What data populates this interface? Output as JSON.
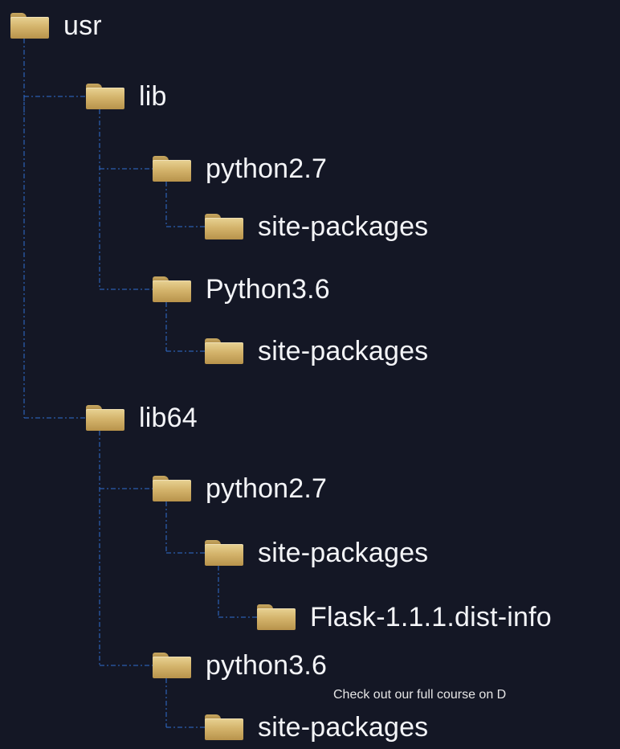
{
  "tree": {
    "line_color": "#2f6fd1",
    "folder_color": "#d4b46c",
    "nodes": [
      {
        "id": "usr",
        "label": "usr",
        "depth": 0
      },
      {
        "id": "lib",
        "label": "lib",
        "depth": 1,
        "parent": "usr"
      },
      {
        "id": "lib-python27",
        "label": "python2.7",
        "depth": 2,
        "parent": "lib"
      },
      {
        "id": "lib-python27-sp",
        "label": "site-packages",
        "depth": 3,
        "parent": "lib-python27"
      },
      {
        "id": "lib-python36",
        "label": "Python3.6",
        "depth": 2,
        "parent": "lib"
      },
      {
        "id": "lib-python36-sp",
        "label": "site-packages",
        "depth": 3,
        "parent": "lib-python36"
      },
      {
        "id": "lib64",
        "label": "lib64",
        "depth": 1,
        "parent": "usr"
      },
      {
        "id": "lib64-python27",
        "label": "python2.7",
        "depth": 2,
        "parent": "lib64"
      },
      {
        "id": "lib64-python27-sp",
        "label": "site-packages",
        "depth": 3,
        "parent": "lib64-python27"
      },
      {
        "id": "flask-dist",
        "label": "Flask-1.1.1.dist-info",
        "depth": 4,
        "parent": "lib64-python27-sp"
      },
      {
        "id": "lib64-python36",
        "label": "python3.6",
        "depth": 2,
        "parent": "lib64"
      },
      {
        "id": "lib64-python36-sp",
        "label": "site-packages",
        "depth": 3,
        "parent": "lib64-python36"
      }
    ]
  },
  "watermark": "Check out our full course on D"
}
